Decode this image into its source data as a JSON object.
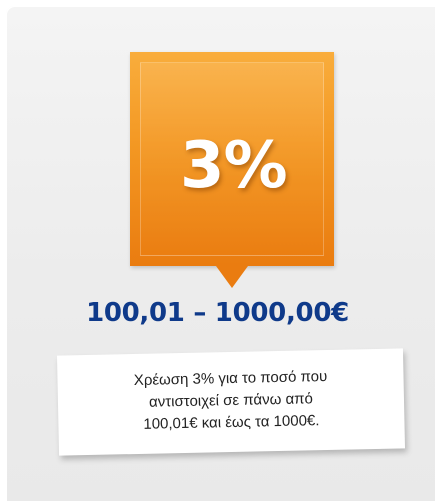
{
  "badge": {
    "value": "3%",
    "color": "#f39722"
  },
  "range": {
    "text": "100,01 – 1000,00€",
    "color": "#0f3a8a"
  },
  "note": {
    "line1": "Χρέωση 3% για το ποσό που",
    "line2": "αντιστοιχεί σε πάνω από",
    "line3": "100,01€ και έως τα 1000€."
  }
}
